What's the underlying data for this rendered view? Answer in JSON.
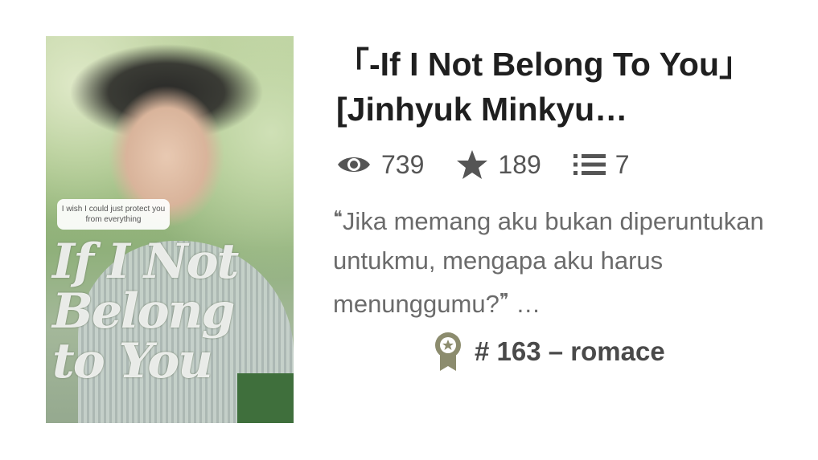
{
  "story": {
    "title": "「-If I Not Belong To You」[Jinhyuk Minkyu…",
    "cover": {
      "bubble_text": "I wish I could just protect you from everything",
      "cover_title": "If I Not Belong to You"
    },
    "stats": {
      "reads": "739",
      "votes": "189",
      "parts": "7",
      "icons": [
        "eye-icon",
        "star-icon",
        "list-icon"
      ]
    },
    "description": {
      "open_quote": "❝",
      "text": "Jika memang aku bukan diperuntukan untukmu, mengapa aku harus menunggumu?",
      "close_quote": "❞",
      "ellipsis": " …"
    },
    "rank": {
      "icon": "ribbon-badge-icon",
      "label": "# 163 – romace"
    }
  },
  "colors": {
    "title": "#1f1f1f",
    "stats": "#555555",
    "description": "#6b6b6b",
    "badge": "#8c8c6e"
  }
}
